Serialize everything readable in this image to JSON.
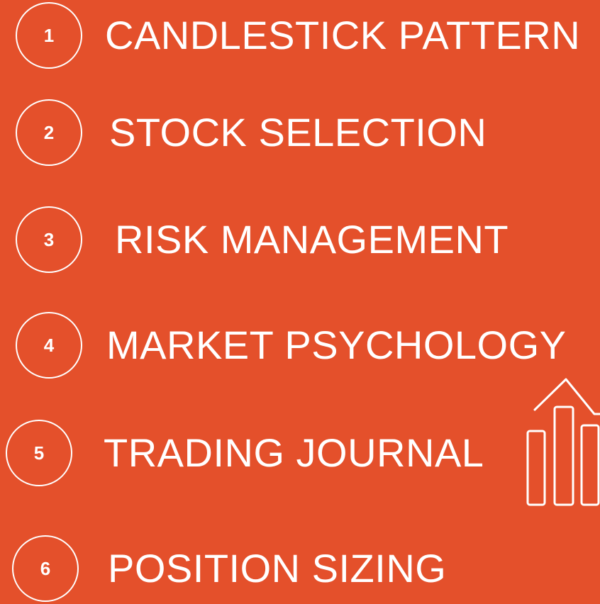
{
  "items": [
    {
      "number": "1",
      "label": "CANDLESTICK PATTERN"
    },
    {
      "number": "2",
      "label": "STOCK SELECTION"
    },
    {
      "number": "3",
      "label": "RISK MANAGEMENT"
    },
    {
      "number": "4",
      "label": "MARKET PSYCHOLOGY"
    },
    {
      "number": "5",
      "label": "TRADING JOURNAL"
    },
    {
      "number": "6",
      "label": "POSITION SIZING"
    }
  ],
  "colors": {
    "background": "#e4502b",
    "foreground": "#ffffff"
  },
  "icons": {
    "decoration": "bar-chart-up-icon"
  }
}
